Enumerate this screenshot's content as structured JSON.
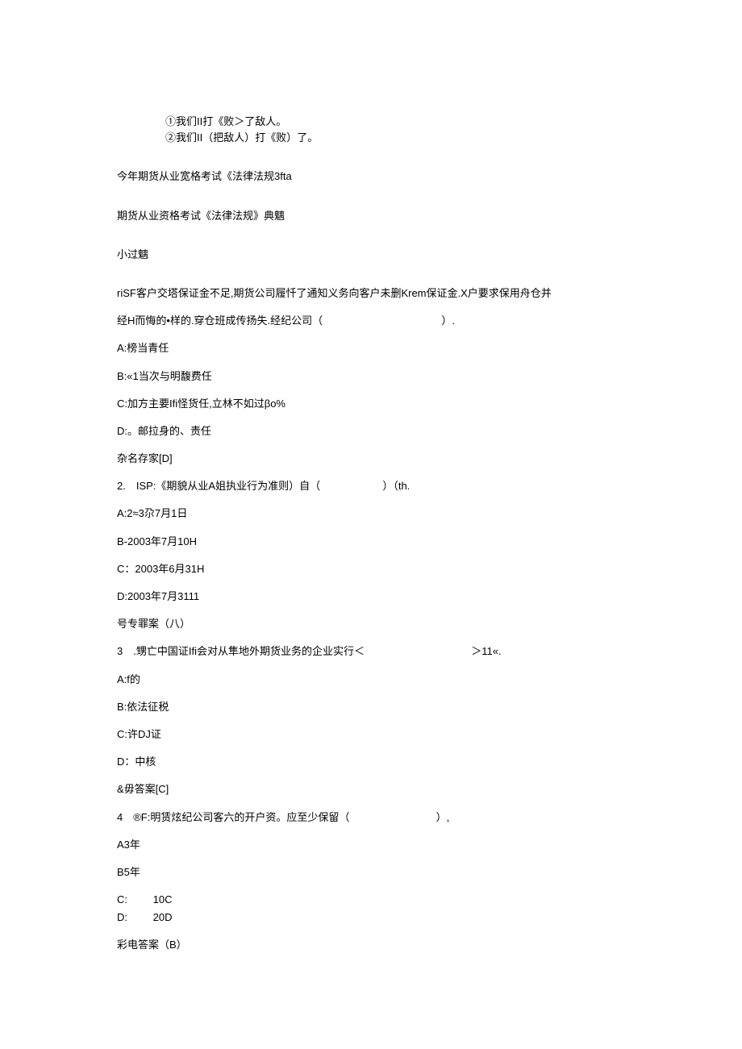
{
  "intro": {
    "line1": "①我们II打《败＞了敌人。",
    "line2": "②我们II（把敌人）打《败）了。"
  },
  "title1": "今年期货从业宽格考试《法律法规3fta",
  "title2": "期货从业资格考试《法律法规》典魑",
  "section": "小过魑",
  "q1": {
    "stem_line1": "riSF客户交塔保证金不足,期货公司履忏了通知义务向客户未删Krem保证金.X户要求保用舟仓并",
    "stem_line2_a": "经H而悔的•样的.穿仓班成传扬失.经纪公司（",
    "stem_line2_b": "）.",
    "a": "A:榜当青任",
    "b": "B:«1当次与明馥费任",
    "c": "C:加方主要Ifi怪货任,立林不如过βo%",
    "d": "D:。邮拉身的、责任",
    "ans": "杂名存家[D]"
  },
  "q2": {
    "stem_a": "2.　ISP:《期貌从业A姐执业行为准则）自（",
    "stem_b": "）（th.",
    "a": "A:2≈3尕7月1日",
    "b": "B-2003年7月10H",
    "c": "C：2003年6月31H",
    "d": "D:2003年7月3111",
    "ans": "号专罪案（八）"
  },
  "q3": {
    "stem_a": "3　.甥亡中国证Ifi会对从隼地外期货业务的企业实行＜",
    "stem_b": "＞11«.",
    "a": "A:f的",
    "b": "B:依法征税",
    "c": "C:许DJ证",
    "d": "D：中核",
    "ans": "&毋答案[C]"
  },
  "q4": {
    "stem_a": "4　®F:明赁炫纪公司客六的开户资。应至少保留（",
    "stem_b": "）,",
    "a": "A3年",
    "b": "B5年",
    "c_label": "C:",
    "c_val": "10C",
    "d_label": "D:",
    "d_val": "20D",
    "ans": "彩电答案（B）"
  }
}
